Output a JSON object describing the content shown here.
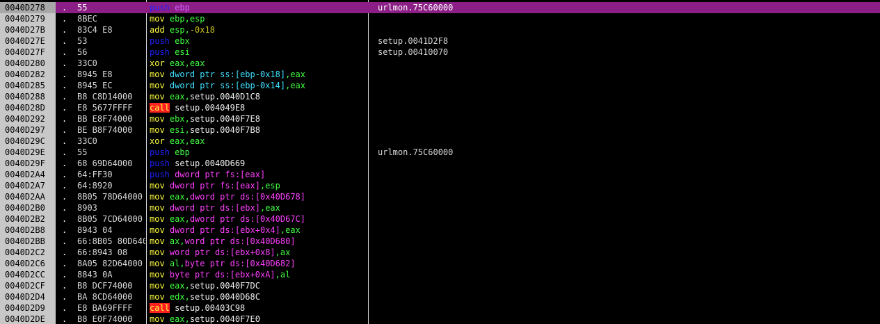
{
  "colors": {
    "background": "#000000",
    "address_column": "#c8c8c8",
    "selected_row": "#8c1f86",
    "call_highlight": "#ff2020",
    "mnemonic_yellow": "#ffff40",
    "push_blue": "#2020ff",
    "register_green": "#40ff40",
    "memory_magenta": "#ff40ff",
    "memory_cyan": "#40e0ff"
  },
  "rows": [
    {
      "address": "0040D278",
      "dot": ".",
      "hex": "55",
      "selected": true,
      "comment": "urlmon.75C60000",
      "tokens": [
        {
          "t": "push",
          "c": "push"
        },
        {
          "t": " "
        },
        {
          "t": "ebp",
          "c": "pushpurple"
        }
      ]
    },
    {
      "address": "0040D279",
      "dot": ".",
      "hex": "8BEC",
      "comment": "",
      "tokens": [
        {
          "t": "mov",
          "c": "mov"
        },
        {
          "t": " "
        },
        {
          "t": "ebp,esp",
          "c": "reg"
        }
      ]
    },
    {
      "address": "0040D27B",
      "dot": ".",
      "hex": "83C4 E8",
      "comment": "",
      "tokens": [
        {
          "t": "add",
          "c": "mov"
        },
        {
          "t": " "
        },
        {
          "t": "esp,",
          "c": "reg"
        },
        {
          "t": "-0x18",
          "c": "imm"
        }
      ]
    },
    {
      "address": "0040D27E",
      "dot": ".",
      "hex": "53",
      "comment": "setup.0041D2F8",
      "tokens": [
        {
          "t": "push",
          "c": "push"
        },
        {
          "t": " "
        },
        {
          "t": "ebx",
          "c": "reg"
        }
      ]
    },
    {
      "address": "0040D27F",
      "dot": ".",
      "hex": "56",
      "comment": "setup.00410070",
      "tokens": [
        {
          "t": "push",
          "c": "push"
        },
        {
          "t": " "
        },
        {
          "t": "esi",
          "c": "reg"
        }
      ]
    },
    {
      "address": "0040D280",
      "dot": ".",
      "hex": "33C0",
      "comment": "",
      "tokens": [
        {
          "t": "xor",
          "c": "mov"
        },
        {
          "t": " "
        },
        {
          "t": "eax,eax",
          "c": "reg"
        }
      ]
    },
    {
      "address": "0040D282",
      "dot": ".",
      "hex": "8945 E8",
      "comment": "",
      "tokens": [
        {
          "t": "mov",
          "c": "mov"
        },
        {
          "t": " "
        },
        {
          "t": "dword ptr ss:[ebp-0x18]",
          "c": "memcyan"
        },
        {
          "t": ",eax",
          "c": "reg"
        }
      ]
    },
    {
      "address": "0040D285",
      "dot": ".",
      "hex": "8945 EC",
      "comment": "",
      "tokens": [
        {
          "t": "mov",
          "c": "mov"
        },
        {
          "t": " "
        },
        {
          "t": "dword ptr ss:[ebp-0x14]",
          "c": "memcyan"
        },
        {
          "t": ",eax",
          "c": "reg"
        }
      ]
    },
    {
      "address": "0040D288",
      "dot": ".",
      "hex": "B8 C8D14000",
      "comment": "",
      "tokens": [
        {
          "t": "mov",
          "c": "mov"
        },
        {
          "t": " "
        },
        {
          "t": "eax,",
          "c": "reg"
        },
        {
          "t": "setup.0040D1C8",
          "c": "white"
        }
      ]
    },
    {
      "address": "0040D28D",
      "dot": ".",
      "hex": "E8 5677FFFF",
      "comment": "",
      "tokens": [
        {
          "t": "call",
          "c": "call"
        },
        {
          "t": " "
        },
        {
          "t": "setup.004049E8",
          "c": "white"
        }
      ]
    },
    {
      "address": "0040D292",
      "dot": ".",
      "hex": "BB E8F74000",
      "comment": "",
      "tokens": [
        {
          "t": "mov",
          "c": "mov"
        },
        {
          "t": " "
        },
        {
          "t": "ebx,",
          "c": "reg"
        },
        {
          "t": "setup.0040F7E8",
          "c": "white"
        }
      ]
    },
    {
      "address": "0040D297",
      "dot": ".",
      "hex": "BE B8F74000",
      "comment": "",
      "tokens": [
        {
          "t": "mov",
          "c": "mov"
        },
        {
          "t": " "
        },
        {
          "t": "esi,",
          "c": "reg"
        },
        {
          "t": "setup.0040F7B8",
          "c": "white"
        }
      ]
    },
    {
      "address": "0040D29C",
      "dot": ".",
      "hex": "33C0",
      "comment": "",
      "tokens": [
        {
          "t": "xor",
          "c": "mov"
        },
        {
          "t": " "
        },
        {
          "t": "eax,eax",
          "c": "reg"
        }
      ]
    },
    {
      "address": "0040D29E",
      "dot": ".",
      "hex": "55",
      "comment": "urlmon.75C60000",
      "tokens": [
        {
          "t": "push",
          "c": "push"
        },
        {
          "t": " "
        },
        {
          "t": "ebp",
          "c": "reg"
        }
      ]
    },
    {
      "address": "0040D29F",
      "dot": ".",
      "hex": "68 69D64000",
      "comment": "",
      "tokens": [
        {
          "t": "push",
          "c": "push"
        },
        {
          "t": " "
        },
        {
          "t": "setup.0040D669",
          "c": "white"
        }
      ]
    },
    {
      "address": "0040D2A4",
      "dot": ".",
      "hex": "64:FF30",
      "comment": "",
      "tokens": [
        {
          "t": "push",
          "c": "push"
        },
        {
          "t": " "
        },
        {
          "t": "dword ptr fs:[eax]",
          "c": "mem"
        }
      ]
    },
    {
      "address": "0040D2A7",
      "dot": ".",
      "hex": "64:8920",
      "comment": "",
      "tokens": [
        {
          "t": "mov",
          "c": "mov"
        },
        {
          "t": " "
        },
        {
          "t": "dword ptr fs:[eax]",
          "c": "mem"
        },
        {
          "t": ",esp",
          "c": "reg"
        }
      ]
    },
    {
      "address": "0040D2AA",
      "dot": ".",
      "hex": "8B05 78D64000",
      "comment": "",
      "tokens": [
        {
          "t": "mov",
          "c": "mov"
        },
        {
          "t": " "
        },
        {
          "t": "eax,",
          "c": "reg"
        },
        {
          "t": "dword ptr ds:[0x40D678]",
          "c": "mem"
        }
      ]
    },
    {
      "address": "0040D2B0",
      "dot": ".",
      "hex": "8903",
      "comment": "",
      "tokens": [
        {
          "t": "mov",
          "c": "mov"
        },
        {
          "t": " "
        },
        {
          "t": "dword ptr ds:[ebx]",
          "c": "mem"
        },
        {
          "t": ",eax",
          "c": "reg"
        }
      ]
    },
    {
      "address": "0040D2B2",
      "dot": ".",
      "hex": "8B05 7CD64000",
      "comment": "",
      "tokens": [
        {
          "t": "mov",
          "c": "mov"
        },
        {
          "t": " "
        },
        {
          "t": "eax,",
          "c": "reg"
        },
        {
          "t": "dword ptr ds:[0x40D67C]",
          "c": "mem"
        }
      ]
    },
    {
      "address": "0040D2B8",
      "dot": ".",
      "hex": "8943 04",
      "comment": "",
      "tokens": [
        {
          "t": "mov",
          "c": "mov"
        },
        {
          "t": " "
        },
        {
          "t": "dword ptr ds:[ebx+0x4]",
          "c": "mem"
        },
        {
          "t": ",eax",
          "c": "reg"
        }
      ]
    },
    {
      "address": "0040D2BB",
      "dot": ".",
      "hex": "66:8B05 80D64000",
      "comment": "",
      "tokens": [
        {
          "t": "mov",
          "c": "mov"
        },
        {
          "t": " "
        },
        {
          "t": "ax,",
          "c": "reg"
        },
        {
          "t": "word ptr ds:[0x40D680]",
          "c": "mem"
        }
      ]
    },
    {
      "address": "0040D2C2",
      "dot": ".",
      "hex": "66:8943 08",
      "comment": "",
      "tokens": [
        {
          "t": "mov",
          "c": "mov"
        },
        {
          "t": " "
        },
        {
          "t": "word ptr ds:[ebx+0x8]",
          "c": "mem"
        },
        {
          "t": ",ax",
          "c": "reg"
        }
      ]
    },
    {
      "address": "0040D2C6",
      "dot": ".",
      "hex": "8A05 82D64000",
      "comment": "",
      "tokens": [
        {
          "t": "mov",
          "c": "mov"
        },
        {
          "t": " "
        },
        {
          "t": "al,",
          "c": "reg"
        },
        {
          "t": "byte ptr ds:[0x40D682]",
          "c": "mem"
        }
      ]
    },
    {
      "address": "0040D2CC",
      "dot": ".",
      "hex": "8843 0A",
      "comment": "",
      "tokens": [
        {
          "t": "mov",
          "c": "mov"
        },
        {
          "t": " "
        },
        {
          "t": "byte ptr ds:[ebx+0xA]",
          "c": "mem"
        },
        {
          "t": ",al",
          "c": "reg"
        }
      ]
    },
    {
      "address": "0040D2CF",
      "dot": ".",
      "hex": "B8 DCF74000",
      "comment": "",
      "tokens": [
        {
          "t": "mov",
          "c": "mov"
        },
        {
          "t": " "
        },
        {
          "t": "eax,",
          "c": "reg"
        },
        {
          "t": "setup.0040F7DC",
          "c": "white"
        }
      ]
    },
    {
      "address": "0040D2D4",
      "dot": ".",
      "hex": "BA 8CD64000",
      "comment": "",
      "tokens": [
        {
          "t": "mov",
          "c": "mov"
        },
        {
          "t": " "
        },
        {
          "t": "edx,",
          "c": "reg"
        },
        {
          "t": "setup.0040D68C",
          "c": "white"
        }
      ]
    },
    {
      "address": "0040D2D9",
      "dot": ".",
      "hex": "E8 BA69FFFF",
      "comment": "",
      "tokens": [
        {
          "t": "call",
          "c": "call"
        },
        {
          "t": " "
        },
        {
          "t": "setup.00403C98",
          "c": "white"
        }
      ]
    },
    {
      "address": "0040D2DE",
      "dot": ".",
      "hex": "B8 E0F74000",
      "comment": "",
      "tokens": [
        {
          "t": "mov",
          "c": "mov"
        },
        {
          "t": " "
        },
        {
          "t": "eax,",
          "c": "reg"
        },
        {
          "t": "setup.0040F7E0",
          "c": "white"
        }
      ]
    }
  ]
}
